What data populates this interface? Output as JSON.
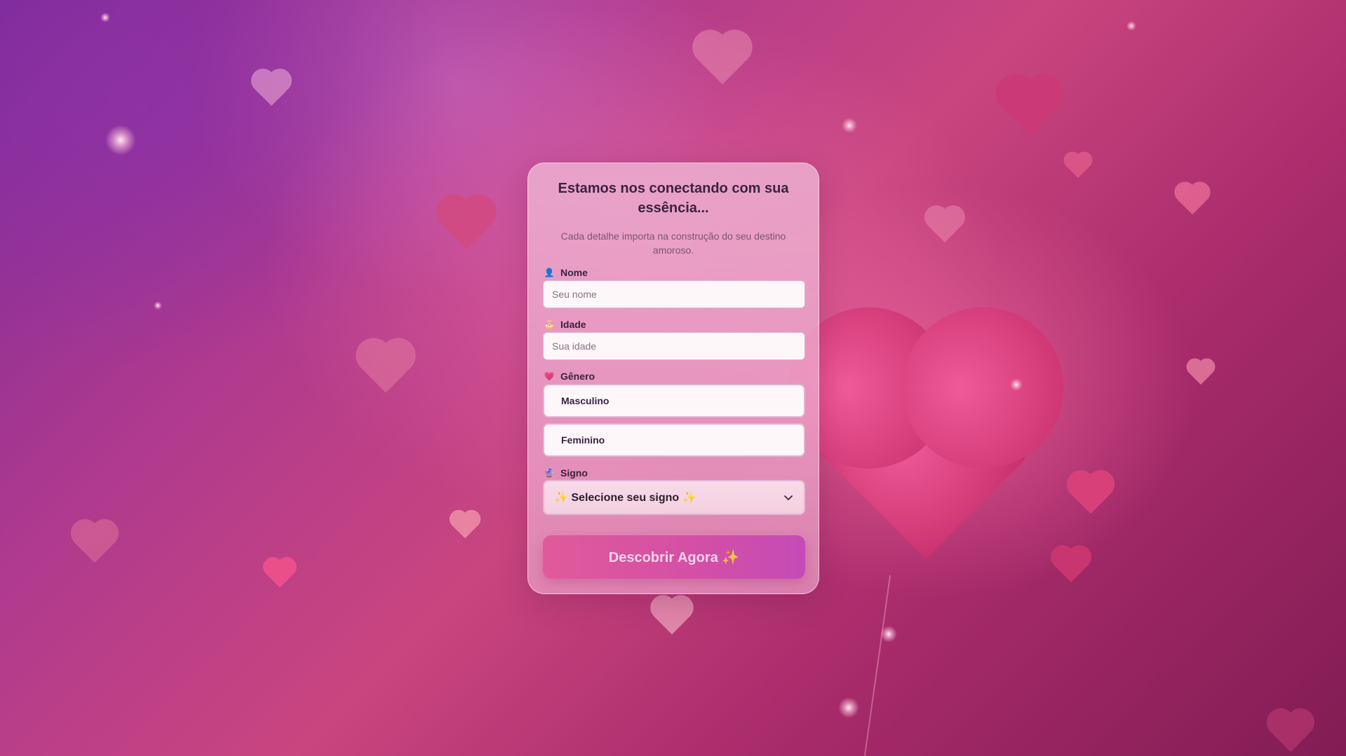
{
  "form": {
    "title": "Estamos nos conectando com sua essência...",
    "subtitle": "Cada detalhe importa na construção do seu destino amoroso.",
    "name_field": {
      "icon": "person-icon",
      "icon_glyph": "👤",
      "label": "Nome",
      "placeholder": "Seu nome",
      "value": ""
    },
    "age_field": {
      "icon": "cake-icon",
      "icon_glyph": "🎂",
      "label": "Idade",
      "placeholder": "Sua idade",
      "value": ""
    },
    "gender_field": {
      "icon": "heart-icon",
      "icon_glyph": "💗",
      "label": "Gênero",
      "options": [
        "Masculino",
        "Feminino"
      ]
    },
    "sign_field": {
      "icon": "crystal-ball-icon",
      "icon_glyph": "🔮",
      "label": "Signo",
      "selected": "✨ Selecione seu signo ✨"
    },
    "submit_label": "Descobrir Agora ✨"
  },
  "colors": {
    "background_start": "#7c2a9a",
    "background_end": "#821c54",
    "button_start": "#e05a9a",
    "button_end": "#c44bb8",
    "text_dark": "#3a2340"
  }
}
